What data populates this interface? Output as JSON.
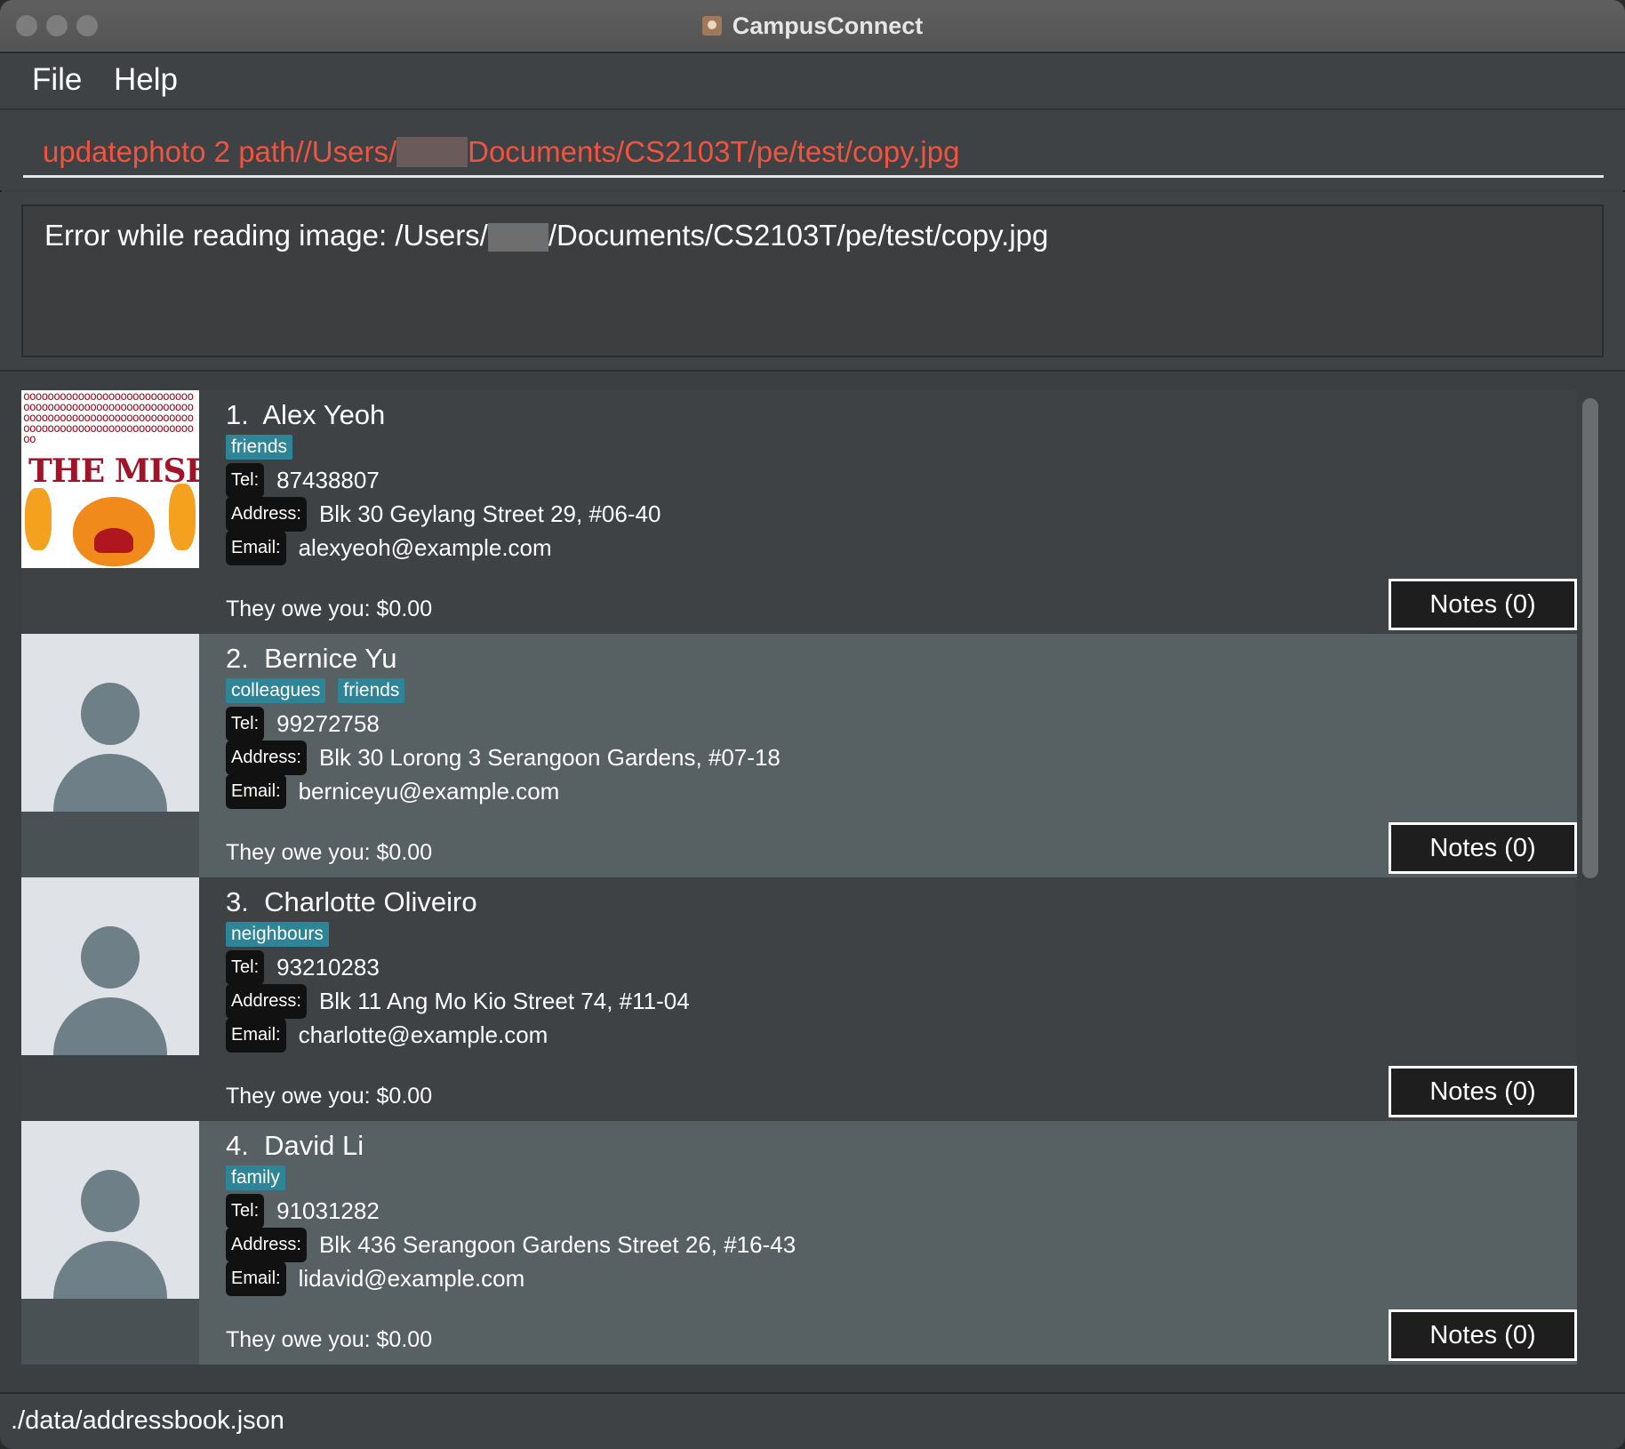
{
  "window": {
    "title": "CampusConnect",
    "app_icon": "address-book-icon"
  },
  "menu": {
    "file": "File",
    "help": "Help"
  },
  "command": {
    "text_before": "updatephoto 2 path//Users/",
    "text_after": "Documents/CS2103T/pe/test/copy.jpg",
    "color": "#f0543f"
  },
  "result": {
    "text_before": "Error while reading image: /Users/",
    "text_after": "/Documents/CS2103T/pe/test/copy.jpg"
  },
  "persons": [
    {
      "index": "1.",
      "name": "Alex Yeoh",
      "tags": [
        "friends"
      ],
      "tel_label": "Tel:",
      "tel": "87438807",
      "address_label": "Address:",
      "address": "Blk 30 Geylang Street 29, #06-40",
      "email_label": "Email:",
      "email": "alexyeoh@example.com",
      "owe": "They owe you: $0.00",
      "notes": "Notes (0)",
      "photo": "misery-image",
      "photo_text": "THE MISERY"
    },
    {
      "index": "2.",
      "name": "Bernice Yu",
      "tags": [
        "colleagues",
        "friends"
      ],
      "tel_label": "Tel:",
      "tel": "99272758",
      "address_label": "Address:",
      "address": "Blk 30 Lorong 3 Serangoon Gardens, #07-18",
      "email_label": "Email:",
      "email": "berniceyu@example.com",
      "owe": "They owe you: $0.00",
      "notes": "Notes (0)",
      "photo": "default-avatar-icon"
    },
    {
      "index": "3.",
      "name": "Charlotte Oliveiro",
      "tags": [
        "neighbours"
      ],
      "tel_label": "Tel:",
      "tel": "93210283",
      "address_label": "Address:",
      "address": "Blk 11 Ang Mo Kio Street 74, #11-04",
      "email_label": "Email:",
      "email": "charlotte@example.com",
      "owe": "They owe you: $0.00",
      "notes": "Notes (0)",
      "photo": "default-avatar-icon"
    },
    {
      "index": "4.",
      "name": "David Li",
      "tags": [
        "family"
      ],
      "tel_label": "Tel:",
      "tel": "91031282",
      "address_label": "Address:",
      "address": "Blk 436 Serangoon Gardens Street 26, #16-43",
      "email_label": "Email:",
      "email": "lidavid@example.com",
      "owe": "They owe you: $0.00",
      "notes": "Notes (0)",
      "photo": "default-avatar-icon"
    }
  ],
  "status": {
    "path": "./data/addressbook.json"
  },
  "colors": {
    "tag": "#2f8598",
    "error": "#f0543f",
    "background": "#3c3f41"
  }
}
